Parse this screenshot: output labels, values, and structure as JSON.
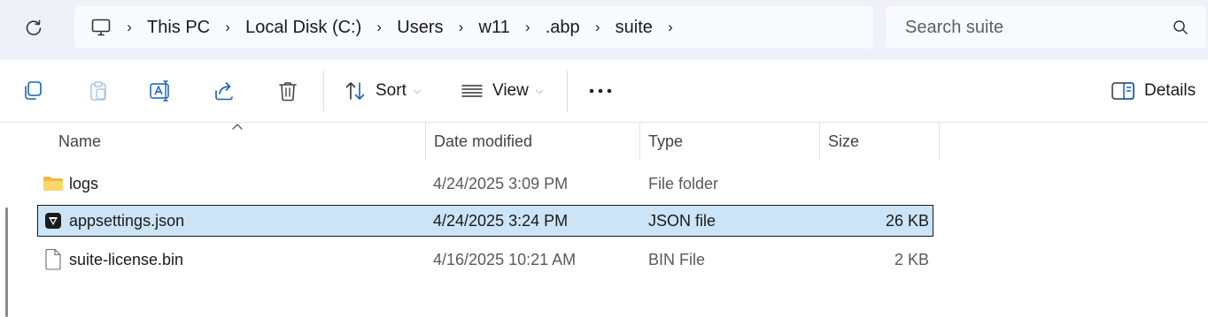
{
  "breadcrumb": {
    "items": [
      "This PC",
      "Local Disk (C:)",
      "Users",
      "w11",
      ".abp",
      "suite"
    ]
  },
  "search": {
    "placeholder": "Search suite"
  },
  "toolbar": {
    "sort_label": "Sort",
    "view_label": "View",
    "details_label": "Details"
  },
  "columns": {
    "name": "Name",
    "date_modified": "Date modified",
    "type": "Type",
    "size": "Size"
  },
  "files": [
    {
      "name": "logs",
      "date": "4/24/2025 3:09 PM",
      "type": "File folder",
      "size": "",
      "icon": "folder-icon",
      "selected": false
    },
    {
      "name": "appsettings.json",
      "date": "4/24/2025 3:24 PM",
      "type": "JSON file",
      "size": "26 KB",
      "icon": "json-file-icon",
      "selected": true
    },
    {
      "name": "suite-license.bin",
      "date": "4/16/2025 10:21 AM",
      "type": "BIN File",
      "size": "2 KB",
      "icon": "file-icon",
      "selected": false
    }
  ],
  "colors": {
    "selection": "#cce4f7",
    "accent": "#0f6cbd",
    "folder": "#f8c64a"
  }
}
